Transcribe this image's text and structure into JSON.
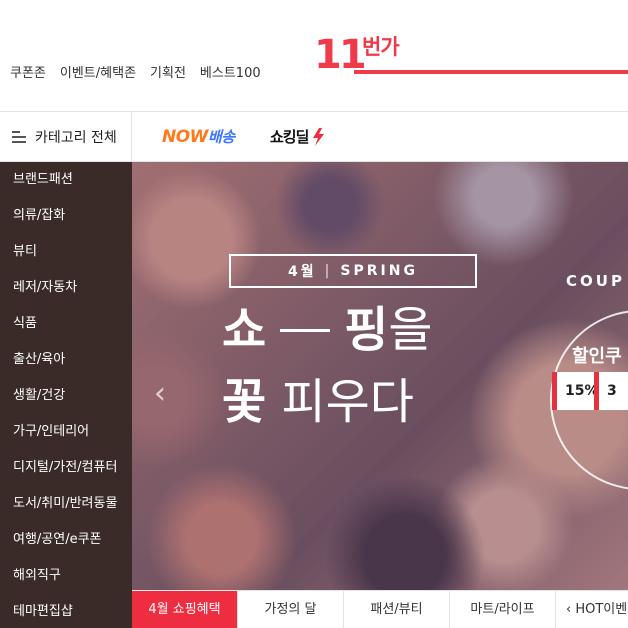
{
  "header": {
    "links": [
      "쿠폰존",
      "이벤트/혜택존",
      "기획전",
      "베스트100"
    ],
    "logo_number": "11",
    "logo_name": "번가"
  },
  "category_bar": {
    "toggle_label": "카테고리 전체",
    "toggle_icon": "menu-icon",
    "now_delivery": {
      "now": "NOW",
      "rest": "배송"
    },
    "shocking_deal": "쇼킹딜",
    "shocking_icon": "bolt-icon"
  },
  "sidebar": {
    "items": [
      "브랜드패션",
      "의류/잡화",
      "뷰티",
      "레저/자동차",
      "식품",
      "출산/육아",
      "생활/건강",
      "가구/인테리어",
      "디지털/가전/컴퓨터",
      "도서/취미/반려동물",
      "여행/공연/e쿠폰",
      "해외직구",
      "테마편집샵"
    ]
  },
  "hero": {
    "month": "4월",
    "season": "SPRING",
    "line1_bold_a": "쇼",
    "line1_bold_b": "핑",
    "line1_thin": "을",
    "line2_bold": "꽃",
    "line2_thin": "피우다",
    "coupon_label": "COUP",
    "coupon_title": "할인쿠",
    "chips": [
      "15%",
      "3"
    ],
    "prev_icon": "chevron-left-icon"
  },
  "tabs": [
    {
      "label": "4월 쇼핑혜택",
      "active": true
    },
    {
      "label": "가정의 달",
      "active": false
    },
    {
      "label": "패션/뷰티",
      "active": false
    },
    {
      "label": "마트/라이프",
      "active": false
    },
    {
      "label": "‹ HOT이벤",
      "active": false
    }
  ],
  "colors": {
    "brand": "#ef3a4a",
    "sidebar_bg": "#3b2b28",
    "active_tab": "#ee2d40",
    "now_orange": "#ff7a1a",
    "now_blue": "#3d76ff"
  }
}
